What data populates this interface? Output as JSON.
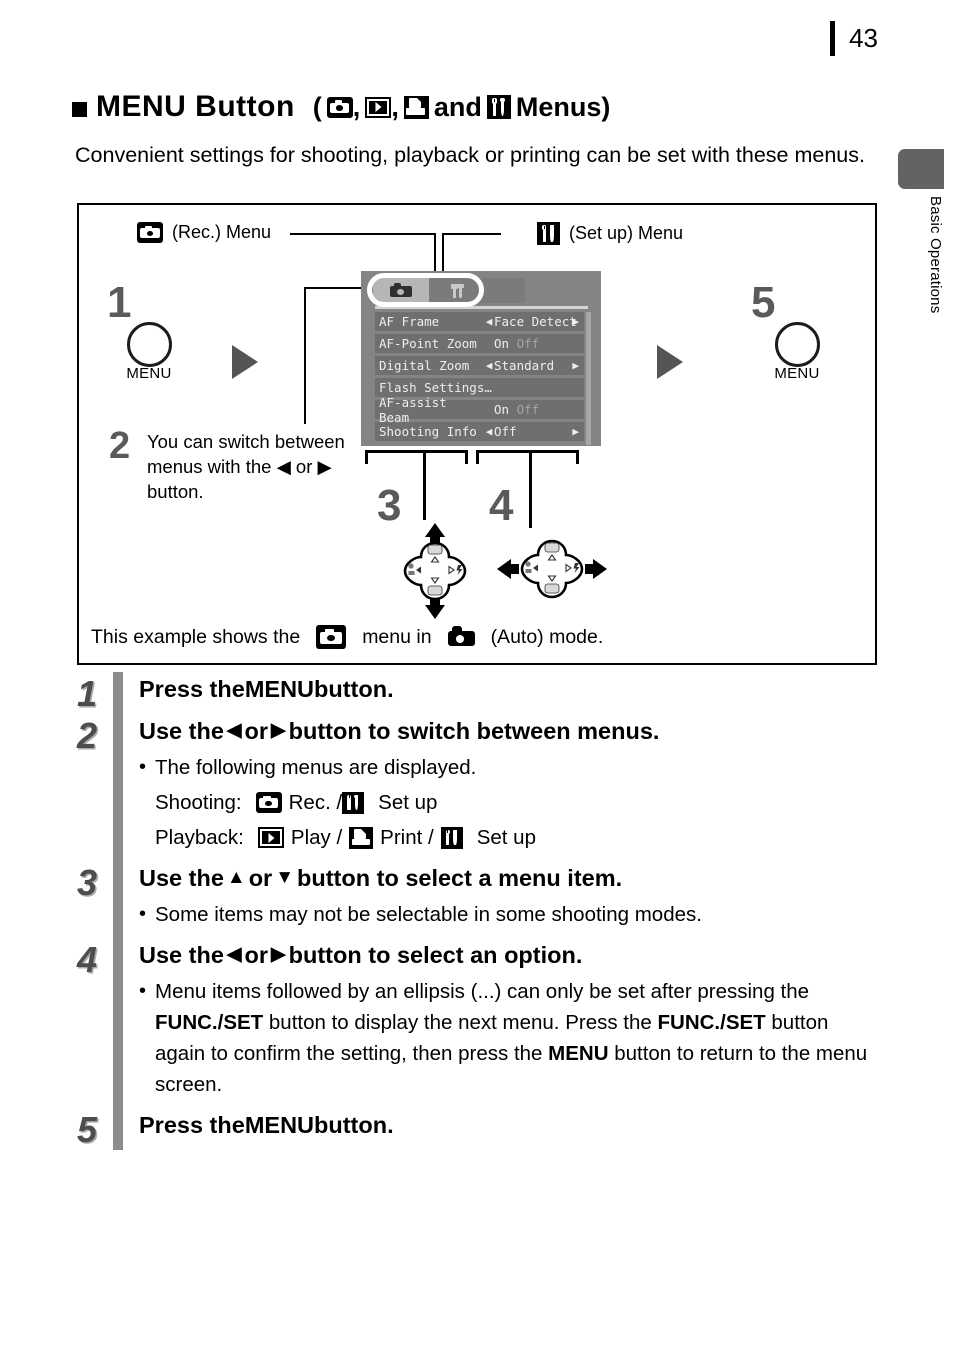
{
  "page": {
    "number": "43",
    "chapter_tab": "Basic Operations"
  },
  "title": {
    "bullet": "square-bullet",
    "main": "MENU Button",
    "paren_open": "(",
    "comma1": ",",
    "comma2": ",",
    "and": "and",
    "menus_word": "Menus)",
    "icons": [
      "rec-icon",
      "play-icon",
      "print-icon",
      "setup-icon"
    ]
  },
  "intro": "Convenient settings for shooting, playback or printing can be set with these menus.",
  "figure": {
    "rec_menu_label": "(Rec.) Menu",
    "setup_menu_label": "(Set up) Menu",
    "num1": "1",
    "num2": "2",
    "num3": "3",
    "num4": "4",
    "num5": "5",
    "menu_button_left": "MENU",
    "menu_button_right": "MENU",
    "note2": "You can switch between menus with the ◀ or ▶ button.",
    "caption_part1": "This example shows the",
    "caption_part2": "menu in",
    "caption_part3": "(Auto) mode.",
    "lcd": {
      "tabs": [
        {
          "name": "rec-tab",
          "icon": "camera-icon",
          "active": true
        },
        {
          "name": "setup-tab",
          "icon": "tools-icon",
          "active": false
        }
      ],
      "rows": [
        {
          "label": "AF Frame",
          "left_arrow": "◀",
          "value": "Face Detect",
          "dim": "",
          "right_arrow": "▶"
        },
        {
          "label": "AF-Point Zoom",
          "left_arrow": "",
          "value": "On ",
          "dim": "Off",
          "right_arrow": ""
        },
        {
          "label": "Digital Zoom",
          "left_arrow": "◀",
          "value": "Standard",
          "dim": "",
          "right_arrow": "▶"
        },
        {
          "label": "Flash Settings…",
          "left_arrow": "",
          "value": "",
          "dim": "",
          "right_arrow": ""
        },
        {
          "label": "AF-assist Beam",
          "left_arrow": "",
          "value": "On ",
          "dim": "Off",
          "right_arrow": ""
        },
        {
          "label": "Shooting Info",
          "left_arrow": "◀",
          "value": "Off",
          "dim": "",
          "right_arrow": "▶"
        }
      ]
    }
  },
  "steps": [
    {
      "num": "1",
      "head_pre": "Press the ",
      "head_bold": "MENU",
      "head_post": " button."
    },
    {
      "num": "2",
      "head_pre": "Use the ",
      "head_glyph1": "◀",
      "head_mid": " or ",
      "head_glyph2": "▶",
      "head_post": " button to switch between menus.",
      "bullet": "The following menus are displayed.",
      "shooting_label": "Shooting:",
      "shooting_rec": "Rec. /",
      "shooting_setup": "Set up",
      "playback_label": "Playback:",
      "playback_play": "Play /",
      "playback_print": "Print /",
      "playback_setup": "Set up"
    },
    {
      "num": "3",
      "head_pre": "Use the ",
      "head_glyph1": "▲",
      "head_mid": " or ",
      "head_glyph2": "▼",
      "head_post": " button to select a menu item.",
      "bullet": "Some items may not be selectable in some shooting modes."
    },
    {
      "num": "4",
      "head_pre": "Use the ",
      "head_glyph1": "◀",
      "head_mid": " or ",
      "head_glyph2": "▶",
      "head_post": " button to select an option.",
      "bullet_p1": "Menu items followed by an ellipsis (...) can only be set after pressing the ",
      "bullet_b1": "FUNC./SET",
      "bullet_p2": " button to display the next menu. Press the ",
      "bullet_b2": "FUNC./SET",
      "bullet_p3": " button again to confirm the setting, then press the ",
      "bullet_b3": "MENU",
      "bullet_p4": " button to return to the menu screen."
    },
    {
      "num": "5",
      "head_pre": "Press the ",
      "head_bold": "MENU",
      "head_post": " button."
    }
  ],
  "colors": {
    "step_number": "#4d4d4d",
    "step_bar": "#8c8c8c",
    "tab": "#636363",
    "lcd_bg": "#848484",
    "lcd_row": "#6f6f6f",
    "arrow": "#555555"
  }
}
